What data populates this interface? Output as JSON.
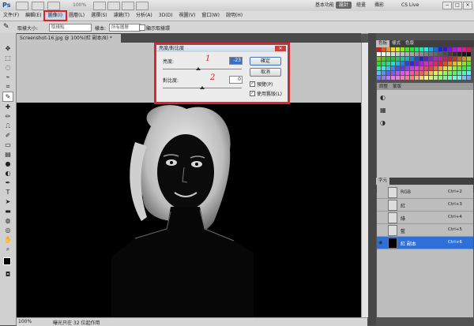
{
  "app": {
    "logo": "Ps",
    "zoom": "100%",
    "workspaces": [
      "基本功能",
      "設計",
      "繪畫",
      "攝影"
    ],
    "active_workspace": "設計",
    "cs_live": "CS Live",
    "window_buttons": [
      "−",
      "□",
      "×"
    ]
  },
  "menu": [
    {
      "label": "文件(F)"
    },
    {
      "label": "編輯(E)"
    },
    {
      "label": "圖像(I)"
    },
    {
      "label": "圖層(L)"
    },
    {
      "label": "選擇(S)"
    },
    {
      "label": "濾鏡(T)"
    },
    {
      "label": "分析(A)"
    },
    {
      "label": "3D(D)"
    },
    {
      "label": "視圖(V)"
    },
    {
      "label": "窗口(W)"
    },
    {
      "label": "說明(H)"
    }
  ],
  "options_bar": {
    "sample_size_label": "取樣大小:",
    "sample_size_value": "取樣點",
    "sample_label": "樣本:",
    "sample_value": "所有圖層",
    "show_ring_label": "顯示取樣環"
  },
  "document": {
    "tab_title": "Screenshot-16.jpg @ 100%(紅 副本/8) *",
    "status_zoom": "100%",
    "status_text": "曝光只在 32 位起作用"
  },
  "dialog": {
    "title": "亮度/對比度",
    "brightness_label": "亮度:",
    "brightness_value": "-23",
    "contrast_label": "對比度:",
    "contrast_value": "0",
    "ok_label": "確定",
    "cancel_label": "取消",
    "preview_label": "預覽(P)",
    "legacy_label": "使用舊版(L)",
    "preview_checked": true,
    "legacy_checked": true,
    "annotation_1": "1",
    "annotation_2": "2",
    "brightness_slider_fraction": 0.45,
    "contrast_slider_fraction": 0.5
  },
  "panels": {
    "swatch_tabs": [
      "色板",
      "樣式",
      "色版"
    ],
    "adjust_tabs": [
      "調整",
      "蒙版"
    ],
    "layer_tabs": [
      "字元"
    ],
    "channel_tabs": [
      "圖層",
      "色版",
      "路徑"
    ],
    "channels": [
      {
        "name": "RGB",
        "shortcut": "Ctrl+2",
        "active": false
      },
      {
        "name": "紅",
        "shortcut": "Ctrl+3",
        "active": false
      },
      {
        "name": "綠",
        "shortcut": "Ctrl+4",
        "active": false
      },
      {
        "name": "藍",
        "shortcut": "Ctrl+5",
        "active": false
      },
      {
        "name": "紅 副本",
        "shortcut": "Ctrl+6",
        "active": true
      }
    ]
  },
  "colors": {
    "highlight_red": "#e0202a",
    "active_blue": "#2f6fd8"
  }
}
